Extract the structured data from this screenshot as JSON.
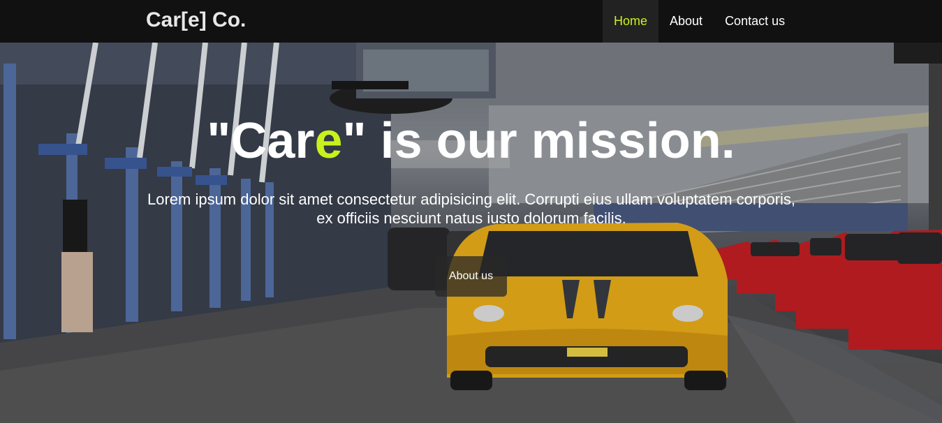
{
  "navbar": {
    "brand": "Car[e] Co.",
    "links": [
      {
        "label": "Home",
        "active": true
      },
      {
        "label": "About",
        "active": false
      },
      {
        "label": "Contact us",
        "active": false
      }
    ],
    "accent_color": "#c9f21d"
  },
  "hero": {
    "title_before": "\"Car",
    "title_accent": "e",
    "title_after": "\" is our mission.",
    "subtitle": "Lorem ipsum dolor sit amet consectetur adipisicing elit. Corrupti eius ullam voluptatem corporis, ex officiis nesciunt natus iusto dolorum facilis.",
    "button_label": "About us",
    "background_image": "race-track-pit-lane-yellow-ferrari-photo"
  }
}
